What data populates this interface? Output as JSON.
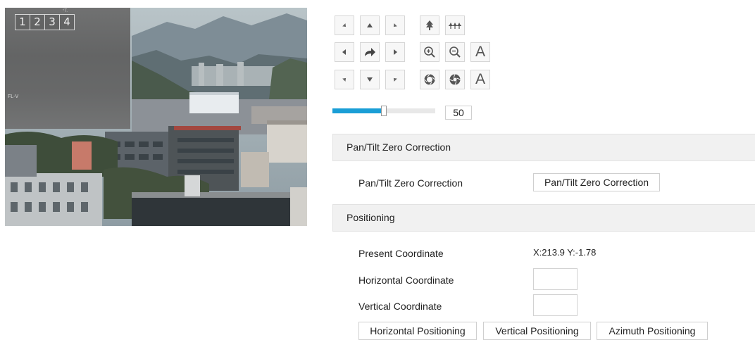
{
  "video": {
    "channels": [
      "1",
      "2",
      "3",
      "4"
    ],
    "overlay_marks": [
      "°T.",
      "FL-V"
    ]
  },
  "ptz": {
    "icons": [
      "arrow-up-left-icon",
      "arrow-up-icon",
      "arrow-up-right-icon",
      "focus-near-icon",
      "focus-far-icon",
      "arrow-left-icon",
      "auto-pan-icon",
      "arrow-right-icon",
      "zoom-in-icon",
      "zoom-out-icon",
      "arrow-down-left-icon",
      "arrow-down-icon",
      "arrow-down-right-icon",
      "iris-open-icon",
      "iris-close-icon"
    ],
    "auto_labels": {
      "zoom_auto": "A",
      "iris_auto": "A"
    }
  },
  "speed": {
    "value": "50",
    "max": 100,
    "level_fraction": 0.5
  },
  "sections": {
    "zero_correction": {
      "header": "Pan/Tilt Zero Correction",
      "label": "Pan/Tilt Zero Correction",
      "button": "Pan/Tilt Zero Correction"
    },
    "positioning": {
      "header": "Positioning",
      "present_label": "Present Coordinate",
      "present_value": "X:213.9 Y:-1.78",
      "horizontal_label": "Horizontal Coordinate",
      "horizontal_value": "",
      "vertical_label": "Vertical Coordinate",
      "vertical_value": "",
      "buttons": {
        "horizontal": "Horizontal Positioning",
        "vertical": "Vertical Positioning",
        "azimuth": "Azimuth Positioning"
      }
    }
  },
  "colors": {
    "accent": "#1a9ed6",
    "header_bg": "#f1f1f1",
    "border": "#cfcfcf"
  }
}
